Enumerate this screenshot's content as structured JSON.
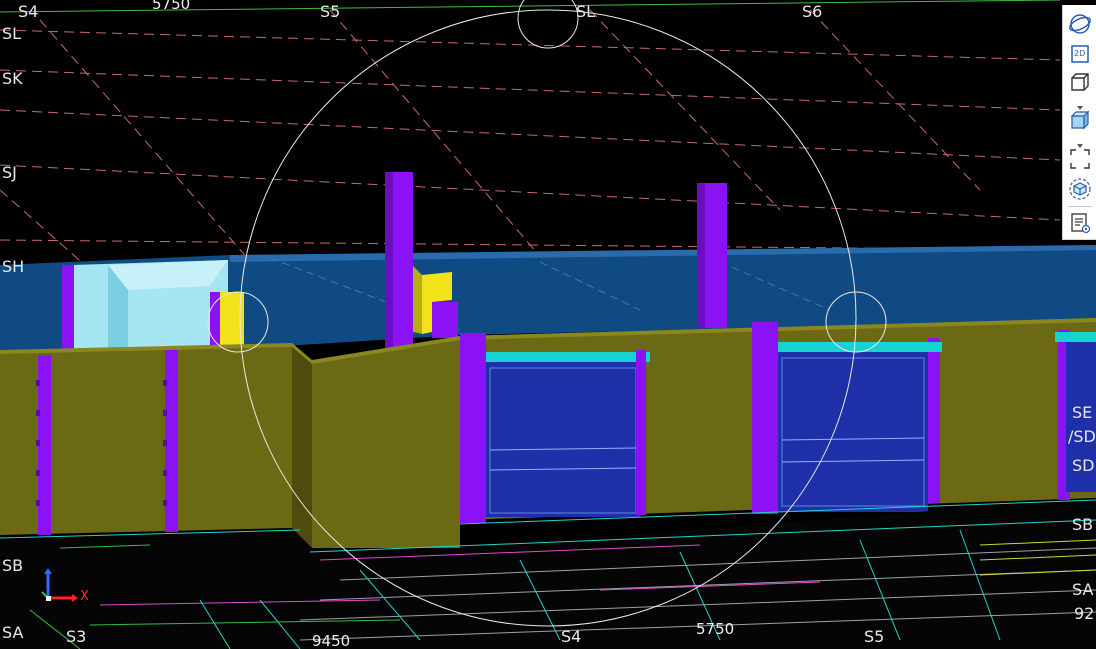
{
  "axes": {
    "top": [
      "S4",
      "S5",
      "SL",
      "S6"
    ],
    "left": [
      "SL",
      "SK",
      "SJ",
      "SH",
      "SB",
      "SA"
    ],
    "right": [
      "SE",
      "/SD",
      "SD",
      "SB",
      "SA",
      "92"
    ],
    "bottom": [
      "S3",
      "S4",
      "S5"
    ]
  },
  "dimensions": {
    "top": "5750",
    "bottom_left": "9450",
    "bottom_right": "5750"
  },
  "triad": {
    "x_label": "X"
  },
  "toolbar": {
    "items": [
      "orbit-view",
      "2d-view",
      "3d-view",
      "shaded-box",
      "fit-view",
      "3d-object",
      "properties-panel"
    ],
    "view_2d_label": "2D"
  },
  "colors": {
    "background": "#000000",
    "wall": "#6b6914",
    "column": "#8a12f4",
    "slab": "#0f4a82",
    "window": "#1e2fa8",
    "window_head": "#14d3d0",
    "light_wall": "#a6e6f2",
    "yellow_part": "#f2e21a",
    "grid_dash": "#c86a6a"
  }
}
